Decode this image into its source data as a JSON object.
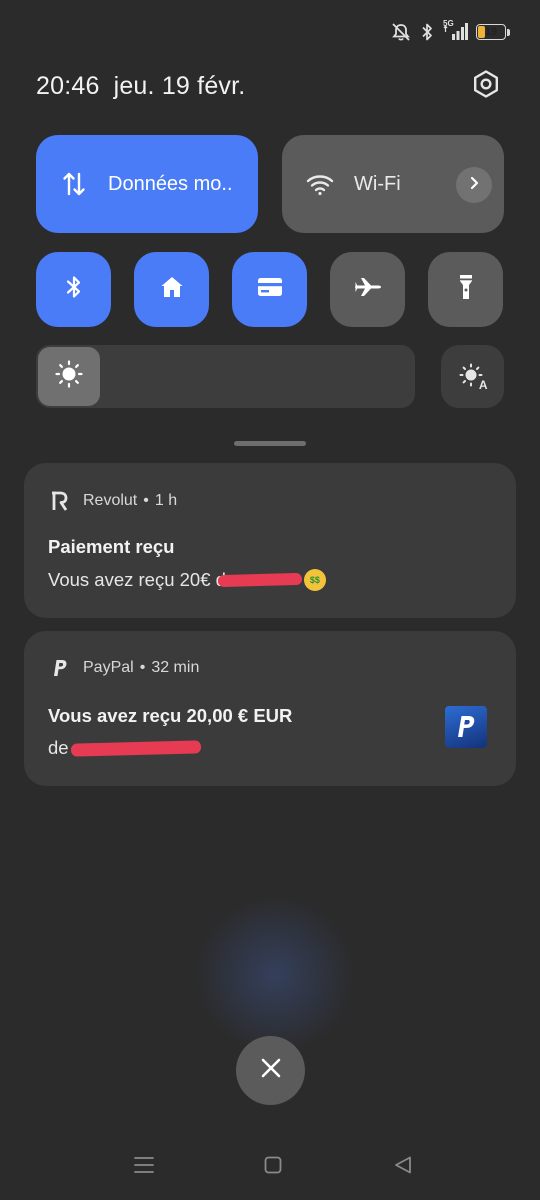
{
  "status_bar": {
    "network": "5G",
    "battery_level": "19",
    "battery_color": "#f0b23a",
    "icons": [
      "mute-icon",
      "bluetooth-icon",
      "signal-icon",
      "battery-icon"
    ]
  },
  "header": {
    "time": "20:46",
    "date": "jeu. 19 févr.",
    "settings_icon": "gear-icon"
  },
  "quick_settings": {
    "accent_color": "#4a7cf7",
    "tiles_large": [
      {
        "label": "Données mo..",
        "icon": "mobile-data-icon",
        "active": true
      },
      {
        "label": "Wi-Fi",
        "icon": "wifi-icon",
        "active": false
      }
    ],
    "tiles_small": [
      {
        "icon": "bluetooth-icon",
        "active": true
      },
      {
        "icon": "home-icon",
        "active": true
      },
      {
        "icon": "card-icon",
        "active": true
      },
      {
        "icon": "airplane-icon",
        "active": false
      },
      {
        "icon": "flashlight-icon",
        "active": false
      }
    ],
    "brightness": {
      "level": 0.0,
      "auto_label": "A"
    }
  },
  "notifications": [
    {
      "app": "Revolut",
      "time": "1 h",
      "title": "Paiement reçu",
      "body": "Vous avez reçu 20€ d"
    },
    {
      "app": "PayPal",
      "time": "32 min",
      "title": "Vous avez reçu 20,00 € EUR",
      "body": "de"
    }
  ],
  "separator": "•"
}
